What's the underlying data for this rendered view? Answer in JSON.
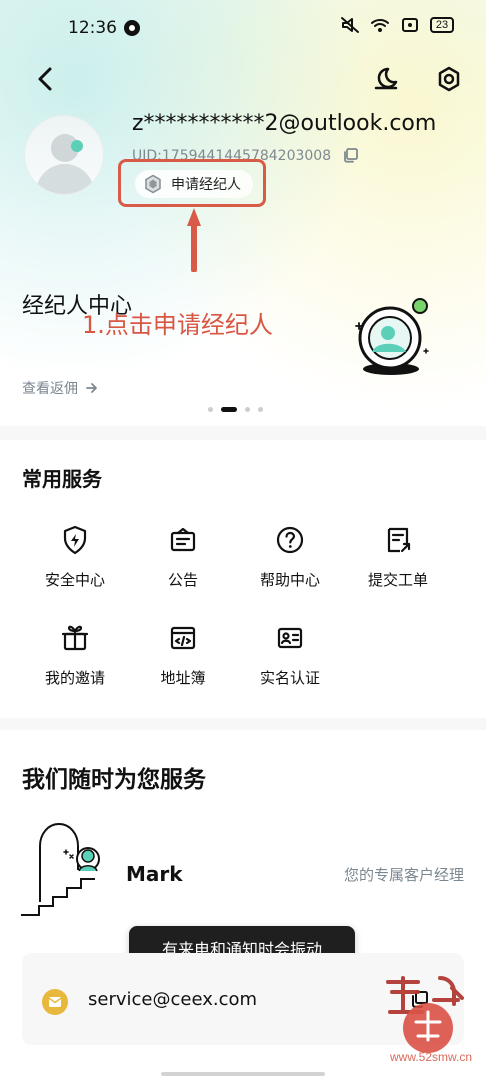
{
  "status_bar": {
    "time": "12:36",
    "battery": "23"
  },
  "profile": {
    "email": "z***********2@outlook.com",
    "uid": "UID:1759441445784203008",
    "apply_label": "申请经纪人"
  },
  "broker_card": {
    "title": "经纪人中心",
    "link": "查看返佣"
  },
  "annotation": {
    "text": "1.点击申请经纪人"
  },
  "services": {
    "title": "常用服务",
    "items": [
      {
        "label": "安全中心",
        "icon": "shield-icon"
      },
      {
        "label": "公告",
        "icon": "notice-icon"
      },
      {
        "label": "帮助中心",
        "icon": "help-icon"
      },
      {
        "label": "提交工单",
        "icon": "ticket-icon"
      },
      {
        "label": "我的邀请",
        "icon": "gift-icon"
      },
      {
        "label": "地址簿",
        "icon": "address-book-icon"
      },
      {
        "label": "实名认证",
        "icon": "id-card-icon"
      }
    ]
  },
  "help": {
    "title": "我们随时为您服务",
    "manager_name": "Mark",
    "manager_role": "您的专属客户经理",
    "contact_email": "service@ceex.com"
  },
  "toast": {
    "text": "有来电和通知时会振动"
  },
  "watermark": {
    "site": "www.52smw.cn"
  },
  "colors": {
    "annotation": "#d95643",
    "accent": "#5bcfb8",
    "mail": "#e8b83c"
  }
}
